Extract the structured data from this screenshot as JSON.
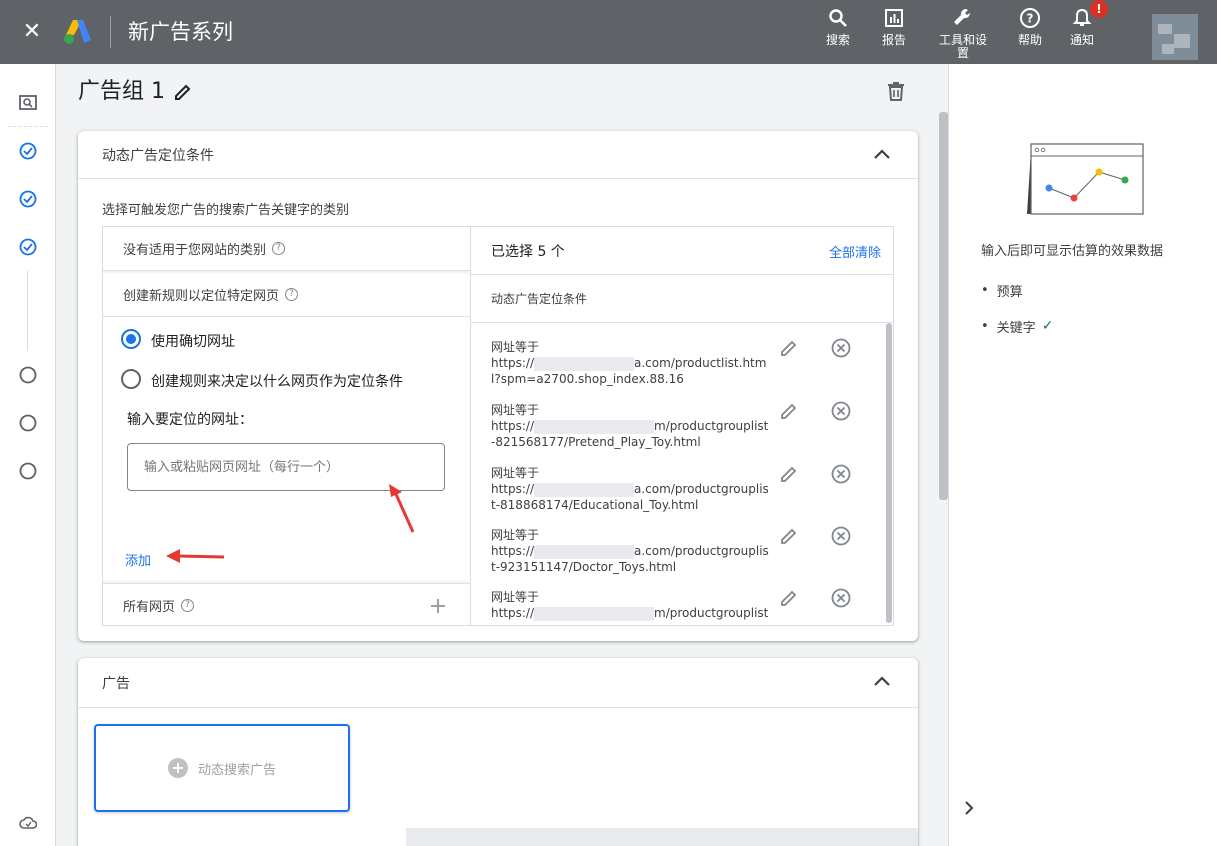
{
  "topbar": {
    "title": "新广告系列",
    "nav": [
      {
        "label": "搜索",
        "icon": "search-icon"
      },
      {
        "label": "报告",
        "icon": "reports-icon"
      },
      {
        "label": "工具和设置",
        "icon": "tools-icon"
      },
      {
        "label": "帮助",
        "icon": "help-icon"
      },
      {
        "label": "通知",
        "icon": "bell-icon",
        "badge": "!"
      }
    ]
  },
  "page": {
    "title": "广告组 1"
  },
  "targeting_card": {
    "header": "动态广告定位条件",
    "subtitle": "选择可触发您广告的搜索广告关键字的类别",
    "left": {
      "no_category": "没有适用于您网站的类别",
      "new_rule": "创建新规则以定位特定网页",
      "radio_exact": "使用确切网址",
      "radio_rules": "创建规则来决定以什么网页作为定位条件",
      "url_label": "输入要定位的网址：",
      "url_placeholder": "输入或粘贴网页网址（每行一个）",
      "add_link": "添加",
      "all_pages": "所有网页"
    },
    "right": {
      "selected": "已选择 5 个",
      "clear_all": "全部清除",
      "subheader": "动态广告定位条件",
      "entries": [
        {
          "label": "网址等于",
          "url_prefix": "https://",
          "url_suffix": "a.com/productlist.html?spm=a2700.shop_index.88.16"
        },
        {
          "label": "网址等于",
          "url_prefix": "https://",
          "url_suffix": "m/productgrouplist-821568177/Pretend_Play_Toy.html"
        },
        {
          "label": "网址等于",
          "url_prefix": "https://",
          "url_suffix": "a.com/productgrouplist-818868174/Educational_Toy.html"
        },
        {
          "label": "网址等于",
          "url_prefix": "https://",
          "url_suffix": "a.com/productgrouplist-923151147/Doctor_Toys.html"
        },
        {
          "label": "网址等于",
          "url_prefix": "https://",
          "url_suffix": "m/productgrouplist-"
        }
      ]
    }
  },
  "ads_card": {
    "header": "广告",
    "new_ad": "动态搜索广告"
  },
  "sidebar": {
    "message": "输入后即可显示估算的效果数据",
    "items": [
      "预算",
      "关键字"
    ]
  },
  "colors": {
    "topbar": "#5f6368",
    "accent": "#1a73e8",
    "annotation": "#e53935"
  }
}
